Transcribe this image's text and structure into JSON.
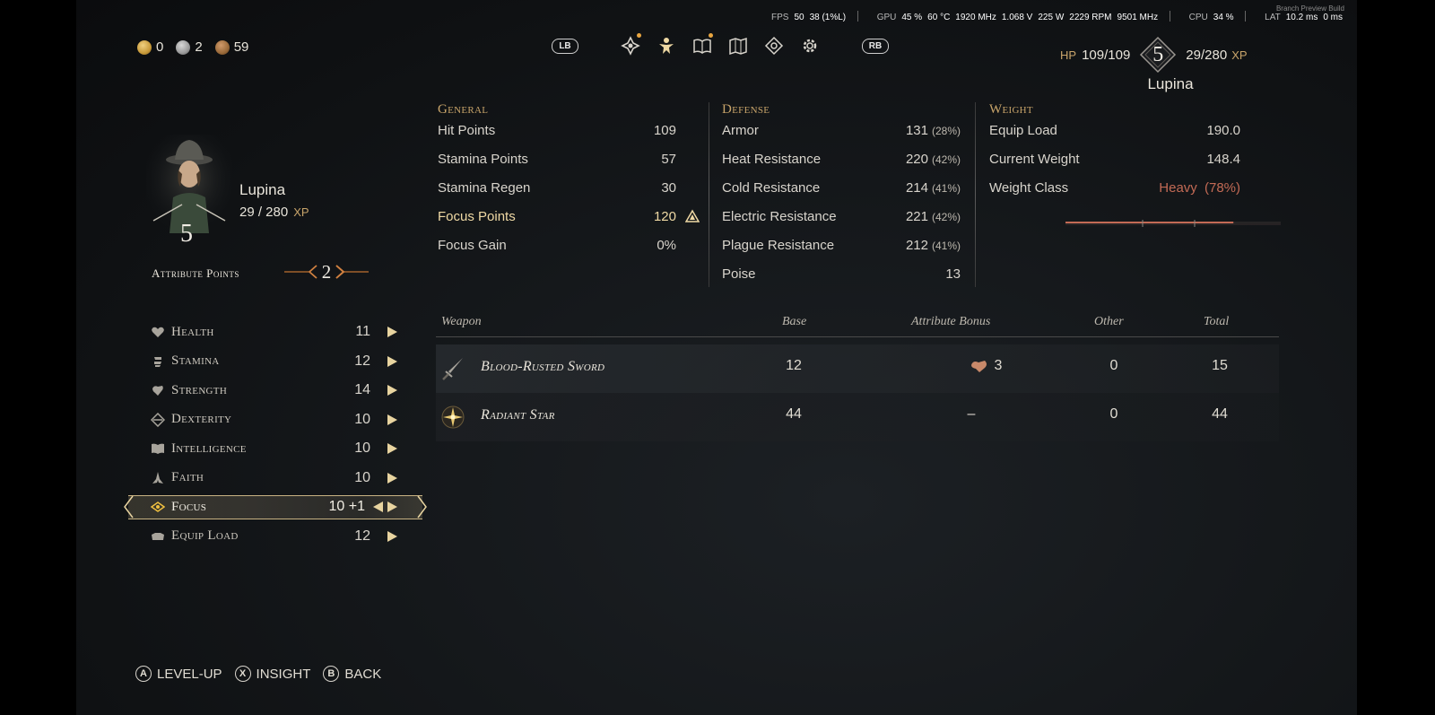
{
  "perf": {
    "preview_label": "Branch Preview Build",
    "fps_label": "FPS",
    "fps": "50",
    "fps_low": "38 (1%L)",
    "gpu_label": "GPU",
    "gpu_usage": "45 %",
    "gpu_temp": "60 °C",
    "gpu_clock": "1920 MHz",
    "gpu_volt": "1.068 V",
    "gpu_power": "225 W",
    "gpu_fan": "2229 RPM",
    "gpu_mem": "9501 MHz",
    "cpu_label": "CPU",
    "cpu": "34 %",
    "lat_label": "LAT",
    "lat": "10.2 ms",
    "lat2": "0 ms"
  },
  "currency": [
    {
      "icon": "gold-coin-icon",
      "value": "0",
      "color": "#c89a3a"
    },
    {
      "icon": "silver-coin-icon",
      "value": "2",
      "color": "#9a9a9a"
    },
    {
      "icon": "copper-coin-icon",
      "value": "59",
      "color": "#9a6a3a"
    }
  ],
  "nav": {
    "lb": "LB",
    "rb": "RB",
    "icons": [
      "quest-icon",
      "character-icon",
      "journal-icon",
      "map-icon",
      "insight-eye-icon",
      "settings-gear-icon"
    ]
  },
  "player": {
    "hp_label": "HP",
    "hp": "109/109",
    "level": "5",
    "xp": "29/280",
    "xp_label": "XP",
    "name": "Lupina",
    "xp_left": "29 / 280",
    "attribute_points_label": "Attribute Points",
    "attribute_points": "2"
  },
  "attributes": [
    {
      "name": "Health",
      "value": "11",
      "icon": "heart-icon"
    },
    {
      "name": "Stamina",
      "value": "12",
      "icon": "stamina-icon"
    },
    {
      "name": "Strength",
      "value": "14",
      "icon": "strength-arm-icon"
    },
    {
      "name": "Dexterity",
      "value": "10",
      "icon": "dexterity-icon"
    },
    {
      "name": "Intelligence",
      "value": "10",
      "icon": "book-icon"
    },
    {
      "name": "Faith",
      "value": "10",
      "icon": "praying-hands-icon"
    },
    {
      "name": "Focus",
      "value": "10 +1",
      "icon": "focus-eye-icon",
      "selected": true
    },
    {
      "name": "Equip Load",
      "value": "12",
      "icon": "equip-load-icon"
    }
  ],
  "general": {
    "heading": "General",
    "rows": [
      {
        "name": "Hit Points",
        "value": "109"
      },
      {
        "name": "Stamina Points",
        "value": "57"
      },
      {
        "name": "Stamina Regen",
        "value": "30"
      },
      {
        "name": "Focus Points",
        "value": "120",
        "highlight": true
      },
      {
        "name": "Focus Gain",
        "value": "0%"
      }
    ]
  },
  "defense": {
    "heading": "Defense",
    "rows": [
      {
        "name": "Armor",
        "value": "131",
        "pct": "(28%)"
      },
      {
        "name": "Heat Resistance",
        "value": "220",
        "pct": "(42%)"
      },
      {
        "name": "Cold Resistance",
        "value": "214",
        "pct": "(41%)"
      },
      {
        "name": "Electric Resistance",
        "value": "221",
        "pct": "(42%)"
      },
      {
        "name": "Plague Resistance",
        "value": "212",
        "pct": "(41%)"
      },
      {
        "name": "Poise",
        "value": "13",
        "pct": ""
      }
    ]
  },
  "weight": {
    "heading": "Weight",
    "equip_load_label": "Equip Load",
    "equip_load": "190.0",
    "current_label": "Current Weight",
    "current": "148.4",
    "class_label": "Weight Class",
    "class_value": "Heavy",
    "class_pct": "(78%)",
    "fill_fraction": 0.78,
    "color": "#c26a55"
  },
  "weapons": {
    "headers": {
      "weapon": "Weapon",
      "base": "Base",
      "bonus": "Attribute Bonus",
      "other": "Other",
      "total": "Total"
    },
    "rows": [
      {
        "name": "Blood-Rusted Sword",
        "icon": "sword-icon",
        "base": "12",
        "bonus": "3",
        "bonus_icon": "strength-arm-icon",
        "other": "0",
        "total": "15"
      },
      {
        "name": "Radiant Star",
        "icon": "radiant-star-icon",
        "base": "44",
        "bonus": "–",
        "other": "0",
        "total": "44"
      }
    ]
  },
  "footer": [
    {
      "button": "A",
      "label": "LEVEL-UP"
    },
    {
      "button": "X",
      "label": "INSIGHT"
    },
    {
      "button": "B",
      "label": "BACK"
    }
  ]
}
